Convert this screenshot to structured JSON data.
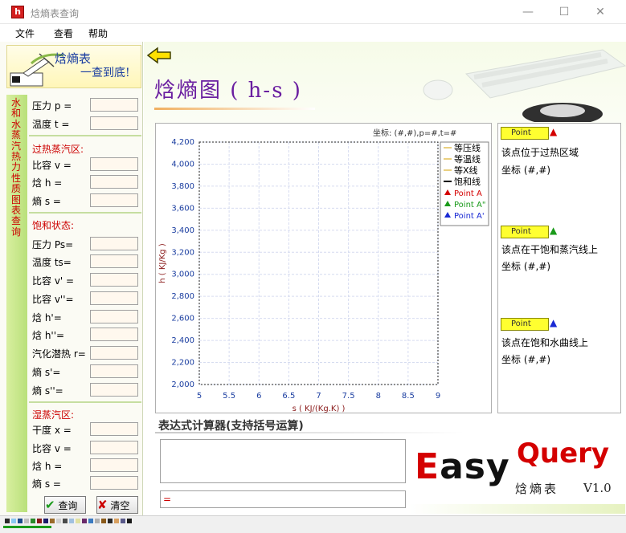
{
  "window": {
    "title": "焓熵表查询",
    "icon_letter": "h"
  },
  "menu": {
    "file": "文件",
    "view": "查看",
    "help": "帮助"
  },
  "logo": {
    "line1": "焓熵表",
    "line2": "一查到底!"
  },
  "sidebar_vertical_text": "水和水蒸汽热力性质图表查询",
  "inputs": {
    "pressure_label": "压力 p =",
    "temperature_label": "温度 t =",
    "superheated_header": "过热蒸汽区:",
    "specific_volume_label": "比容 v =",
    "enthalpy_label": "焓  h =",
    "entropy_label": "熵  s =",
    "saturation_header": "饱和状态:",
    "ps_label": "压力 Ps=",
    "ts_label": "温度 ts=",
    "v1_label": "比容 v' =",
    "v2_label": "比容 v''=",
    "h1_label": "焓  h'=",
    "h2_label": "焓  h''=",
    "r_label": "汽化潜热 r=",
    "s1_label": "熵  s'=",
    "s2_label": "熵  s''=",
    "wet_header": "湿蒸汽区:",
    "x_label": "干度 x =",
    "wet_v_label": "比容 v =",
    "wet_h_label": "焓  h =",
    "wet_s_label": "熵  s ="
  },
  "buttons": {
    "query": "查询",
    "clear": "清空"
  },
  "main_title": "焓熵图  ( h-s )",
  "coord_readout": "坐标: (#,#),p=#,t=#",
  "chart_data": {
    "type": "line",
    "title": "",
    "xlabel": "s ( KJ/(Kg.K) )",
    "ylabel": "h ( KJ/Kg )",
    "xlim": [
      5,
      9
    ],
    "ylim": [
      2000,
      4200
    ],
    "x_ticks": [
      "5",
      "5.5",
      "6",
      "6.5",
      "7",
      "7.5",
      "8",
      "8.5",
      "9"
    ],
    "y_ticks": [
      "2,000",
      "2,200",
      "2,400",
      "2,600",
      "2,800",
      "3,000",
      "3,200",
      "3,400",
      "3,600",
      "3,800",
      "4,000",
      "4,200"
    ],
    "grid": true,
    "legend_position": "top-right",
    "legend": [
      {
        "name": "等压线",
        "kind": "line",
        "color": "#d4a000"
      },
      {
        "name": "等温线",
        "kind": "line",
        "color": "#d4a000"
      },
      {
        "name": "等X线",
        "kind": "line",
        "color": "#d4a000"
      },
      {
        "name": "饱和线",
        "kind": "line",
        "color": "#000000"
      },
      {
        "name": "Point A",
        "kind": "triangle",
        "color": "#d40000"
      },
      {
        "name": "Point A\"",
        "kind": "triangle",
        "color": "#1a9a1a"
      },
      {
        "name": "Point A'",
        "kind": "triangle",
        "color": "#1a2ad4"
      }
    ],
    "series": []
  },
  "points_panel": {
    "badge": "Point",
    "p1_desc": "该点位于过热区域",
    "p1_coord": "坐标 (#,#)",
    "p2_desc": "该点在干饱和蒸汽线上",
    "p2_coord": "坐标 (#,#)",
    "p3_desc": "该点在饱和水曲线上",
    "p3_coord": "坐标 (#,#)",
    "colors": {
      "p1": "#d40000",
      "p2": "#1a9a1a",
      "p3": "#1a2ad4"
    }
  },
  "calculator": {
    "title": "表达式计算器(支持括号运算)",
    "result": "="
  },
  "brand": {
    "easy_first": "E",
    "easy_rest": "asy",
    "query": "Query",
    "subtitle": "焓熵表",
    "version": "V1.0"
  }
}
